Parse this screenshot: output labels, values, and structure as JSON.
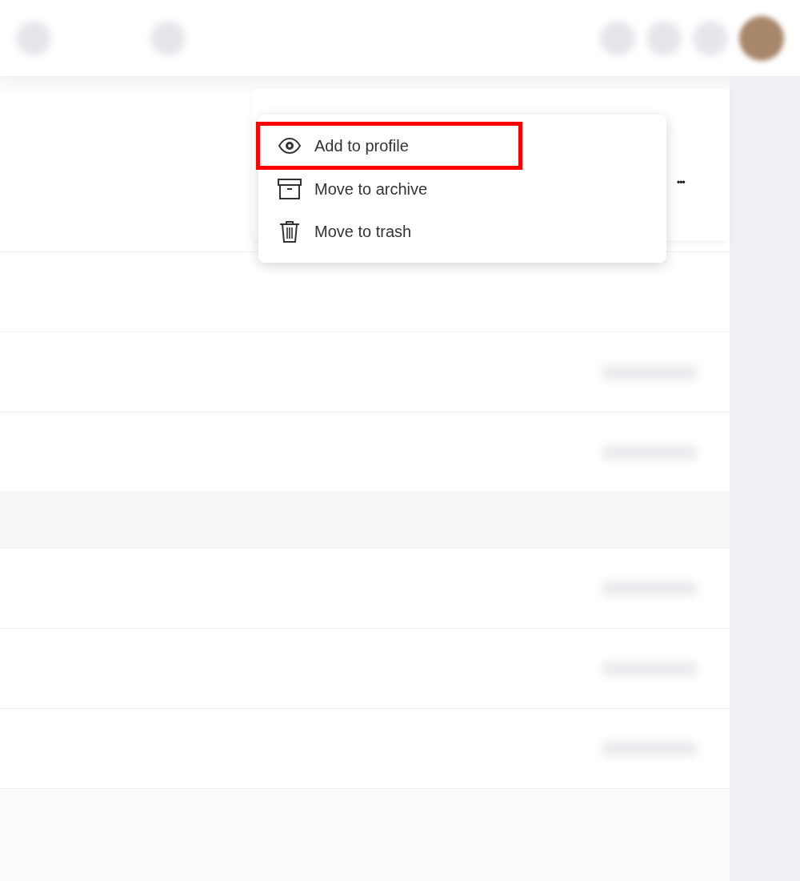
{
  "menu": {
    "items": [
      {
        "kind": "eye",
        "label": "Add to profile",
        "highlighted": true
      },
      {
        "kind": "archive",
        "label": "Move to archive",
        "highlighted": false
      },
      {
        "kind": "trash",
        "label": "Move to trash",
        "highlighted": false
      }
    ]
  },
  "card": {
    "more_button": "•••"
  }
}
